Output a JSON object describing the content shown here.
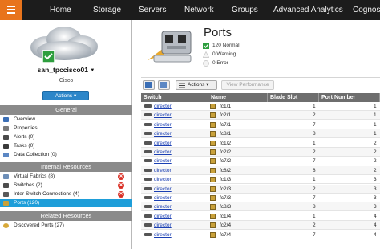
{
  "nav": {
    "items": [
      "Home",
      "Storage",
      "Servers",
      "Network",
      "Groups",
      "Advanced Analytics",
      "Cognos"
    ]
  },
  "device": {
    "name": "san_tpccisco01",
    "vendor": "Cisco",
    "actions_label": "Actions",
    "status_color": "#2e9e3e"
  },
  "sections": {
    "general": {
      "header": "General",
      "items": [
        {
          "label": "Overview",
          "icon": "overview-icon"
        },
        {
          "label": "Properties",
          "icon": "properties-icon"
        },
        {
          "label": "Alerts (0)",
          "icon": "alert-icon"
        },
        {
          "label": "Tasks (0)",
          "icon": "tasks-icon"
        },
        {
          "label": "Data Collection (0)",
          "icon": "data-collection-icon"
        }
      ]
    },
    "internal": {
      "header": "Internal Resources",
      "items": [
        {
          "label": "Virtual Fabrics (8)",
          "icon": "fabric-icon",
          "error": true
        },
        {
          "label": "Switches (2)",
          "icon": "switch-icon",
          "error": true
        },
        {
          "label": "Inter-Switch Connections (4)",
          "icon": "connection-icon",
          "error": true
        },
        {
          "label": "Ports (120)",
          "icon": "port-icon",
          "error": false,
          "selected": true
        }
      ]
    },
    "related": {
      "header": "Related Resources",
      "items": [
        {
          "label": "Discovered Ports (27)",
          "icon": "discovered-ports-icon"
        }
      ]
    }
  },
  "main": {
    "title": "Ports",
    "stats": [
      {
        "text": "120 Normal",
        "icon": "normal-check-icon"
      },
      {
        "text": "0 Warning",
        "icon": "warning-icon"
      },
      {
        "text": "0 Error",
        "icon": "error-icon"
      }
    ],
    "toolbar": {
      "actions_label": "Actions",
      "view_performance_label": "View Performance"
    },
    "table": {
      "columns": [
        "Switch",
        "Name",
        "Blade Slot",
        "Port Number"
      ],
      "rows": [
        {
          "switch": "director",
          "name": "fc1/1",
          "blade_slot": "1",
          "port": "1"
        },
        {
          "switch": "director",
          "name": "fc2/1",
          "blade_slot": "2",
          "port": "1"
        },
        {
          "switch": "director",
          "name": "fc7/1",
          "blade_slot": "7",
          "port": "1"
        },
        {
          "switch": "director",
          "name": "fc8/1",
          "blade_slot": "8",
          "port": "1"
        },
        {
          "switch": "director",
          "name": "fc1/2",
          "blade_slot": "1",
          "port": "2"
        },
        {
          "switch": "director",
          "name": "fc2/2",
          "blade_slot": "2",
          "port": "2"
        },
        {
          "switch": "director",
          "name": "fc7/2",
          "blade_slot": "7",
          "port": "2"
        },
        {
          "switch": "director",
          "name": "fc8/2",
          "blade_slot": "8",
          "port": "2"
        },
        {
          "switch": "director",
          "name": "fc1/3",
          "blade_slot": "1",
          "port": "3"
        },
        {
          "switch": "director",
          "name": "fc2/3",
          "blade_slot": "2",
          "port": "3"
        },
        {
          "switch": "director",
          "name": "fc7/3",
          "blade_slot": "7",
          "port": "3"
        },
        {
          "switch": "director",
          "name": "fc8/3",
          "blade_slot": "8",
          "port": "3"
        },
        {
          "switch": "director",
          "name": "fc1/4",
          "blade_slot": "1",
          "port": "4"
        },
        {
          "switch": "director",
          "name": "fc2/4",
          "blade_slot": "2",
          "port": "4"
        },
        {
          "switch": "director",
          "name": "fc7/4",
          "blade_slot": "7",
          "port": "4"
        }
      ]
    }
  }
}
